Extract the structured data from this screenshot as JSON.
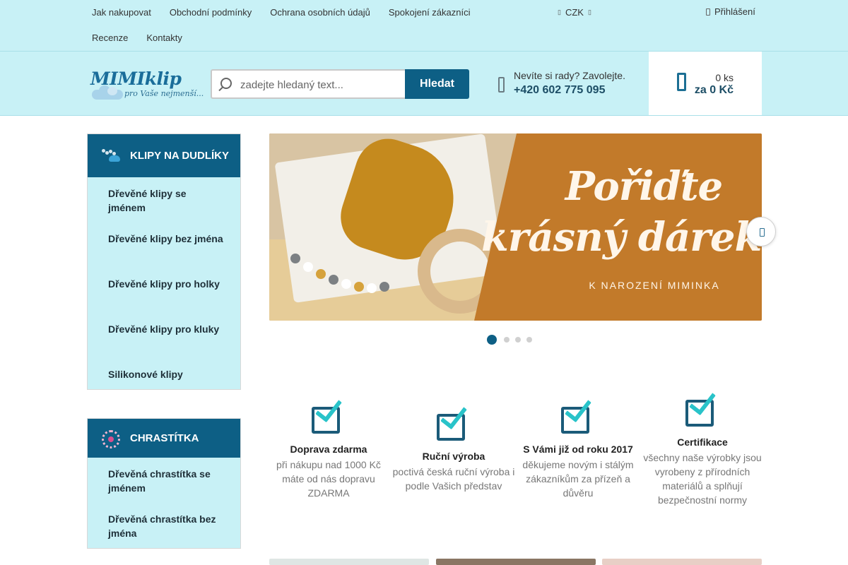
{
  "topnav": {
    "links_row1": [
      "Jak nakupovat",
      "Obchodní podmínky",
      "Ochrana osobních údajů",
      "Spokojení zákazníci"
    ],
    "links_row2": [
      "Recenze",
      "Kontakty"
    ],
    "currency": "CZK",
    "login": "Přihlášení"
  },
  "header": {
    "logo_brand": "MIMIklip",
    "logo_tagline": "pro Vaše nejmenší...",
    "search_placeholder": "zadejte hledaný text...",
    "search_button": "Hledat",
    "contact_question": "Nevíte si rady? Zavolejte.",
    "contact_phone": "+420 602 775 095",
    "cart_count": "0 ks",
    "cart_total": "za 0 Kč"
  },
  "sidebar": {
    "categories": [
      {
        "title": "KLIPY NA DUDLÍKY",
        "icon": "pacifier-clip-icon",
        "items": [
          "Dřevěné klipy se jménem",
          "Dřevěné klipy bez jména",
          "Dřevěné klipy pro holky",
          "Dřevěné klipy pro kluky",
          "Silikonové klipy"
        ]
      },
      {
        "title": "CHRASTÍTKA",
        "icon": "rattle-icon",
        "items": [
          "Dřevěná chrastítka se jménem",
          "Dřevěná chrastítka bez jména"
        ]
      }
    ]
  },
  "banner": {
    "line1": "Pořiďte",
    "line2": "krásný dárek",
    "line3": "K NAROZENÍ MIMINKA",
    "slides": 4,
    "active_slide": 1
  },
  "benefits": [
    {
      "title": "Doprava zdarma",
      "text": "při nákupu nad 1000 Kč máte od nás dopravu ZDARMA"
    },
    {
      "title": "Ruční výroba",
      "text": "poctivá česká ruční výroba i podle Vašich představ"
    },
    {
      "title": "S Vámi již od roku 2017",
      "text": "děkujeme novým i stálým zákazníkům za přízeň a důvěru"
    },
    {
      "title": "Certifikace",
      "text": "všechny naše výrobky jsou vyrobeny z přírodních materiálů a splňují bezpečnostní normy"
    }
  ],
  "colors": {
    "header_bg": "#c8f1f6",
    "primary": "#0d5f85",
    "accent_check": "#29c3c9",
    "banner_orange": "#c27a2a"
  }
}
